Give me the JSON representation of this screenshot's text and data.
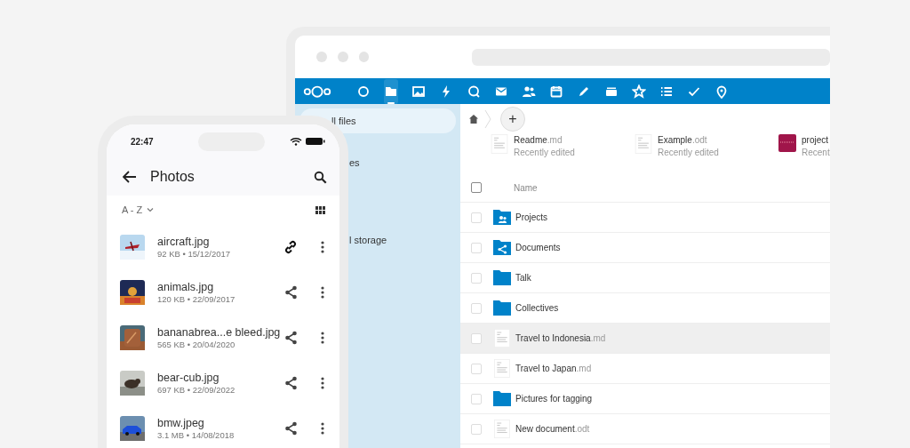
{
  "browser": {
    "apps": [
      {
        "kind": "logo",
        "selected": false
      },
      {
        "kind": "dashboard",
        "selected": false
      },
      {
        "kind": "files",
        "selected": true
      },
      {
        "kind": "photos",
        "selected": false
      },
      {
        "kind": "activity",
        "selected": false
      },
      {
        "kind": "talk",
        "selected": false
      },
      {
        "kind": "mail",
        "selected": false
      },
      {
        "kind": "contacts",
        "selected": false
      },
      {
        "kind": "calendar",
        "selected": false
      },
      {
        "kind": "notes",
        "selected": false
      },
      {
        "kind": "deck",
        "selected": false
      },
      {
        "kind": "star",
        "selected": false
      },
      {
        "kind": "list",
        "selected": false
      },
      {
        "kind": "tasks",
        "selected": false
      },
      {
        "kind": "maps",
        "selected": false
      }
    ],
    "sidebar": {
      "items": [
        {
          "label": "ll files",
          "selected": true
        },
        {
          "label": "es",
          "selected": false
        },
        {
          "label": "l storage",
          "selected": false
        }
      ]
    },
    "breadcrumb": {
      "add": "+"
    },
    "recent": [
      {
        "name": "Readme",
        "ext": ".md",
        "subtitle": "Recently edited",
        "kind": "text"
      },
      {
        "name": "Example",
        "ext": ".odt",
        "subtitle": "Recently edited",
        "kind": "text"
      },
      {
        "name": "project",
        "subtitle": "Recent",
        "kind": "picture"
      }
    ],
    "files": {
      "column": "Name",
      "all_checked": false,
      "rows": [
        {
          "name": "Projects",
          "kind": "group-folder",
          "checked": false,
          "selected": false
        },
        {
          "name": "Documents",
          "kind": "shared-folder",
          "checked": false,
          "selected": false
        },
        {
          "name": "Talk",
          "kind": "folder",
          "checked": false,
          "selected": false
        },
        {
          "name": "Collectives",
          "kind": "folder",
          "checked": false,
          "selected": false
        },
        {
          "name": "Travel to Indonesia",
          "ext": ".md",
          "kind": "text",
          "checked": false,
          "selected": true
        },
        {
          "name": "Travel to Japan",
          "ext": ".md",
          "kind": "text",
          "checked": false,
          "selected": false
        },
        {
          "name": "Pictures for tagging",
          "kind": "folder",
          "checked": false,
          "selected": false
        },
        {
          "name": "New document",
          "ext": ".odt",
          "kind": "text",
          "checked": false,
          "selected": false
        }
      ]
    }
  },
  "phone": {
    "time": "22:47",
    "title": "Photos",
    "sort": "A - Z",
    "items": [
      {
        "name": "aircraft.jpg",
        "meta": "92 KB • 15/12/2017",
        "kind": "link"
      },
      {
        "name": "animals.jpg",
        "meta": "120 KB • 22/09/2017",
        "kind": "share"
      },
      {
        "name": "bananabrea...e bleed.jpg",
        "meta": "565 KB • 20/04/2020",
        "kind": "share"
      },
      {
        "name": "bear-cub.jpg",
        "meta": "697 KB • 22/09/2022",
        "kind": "share"
      },
      {
        "name": "bmw.jpeg",
        "meta": "3.1 MB • 14/08/2018",
        "kind": "share"
      }
    ]
  }
}
